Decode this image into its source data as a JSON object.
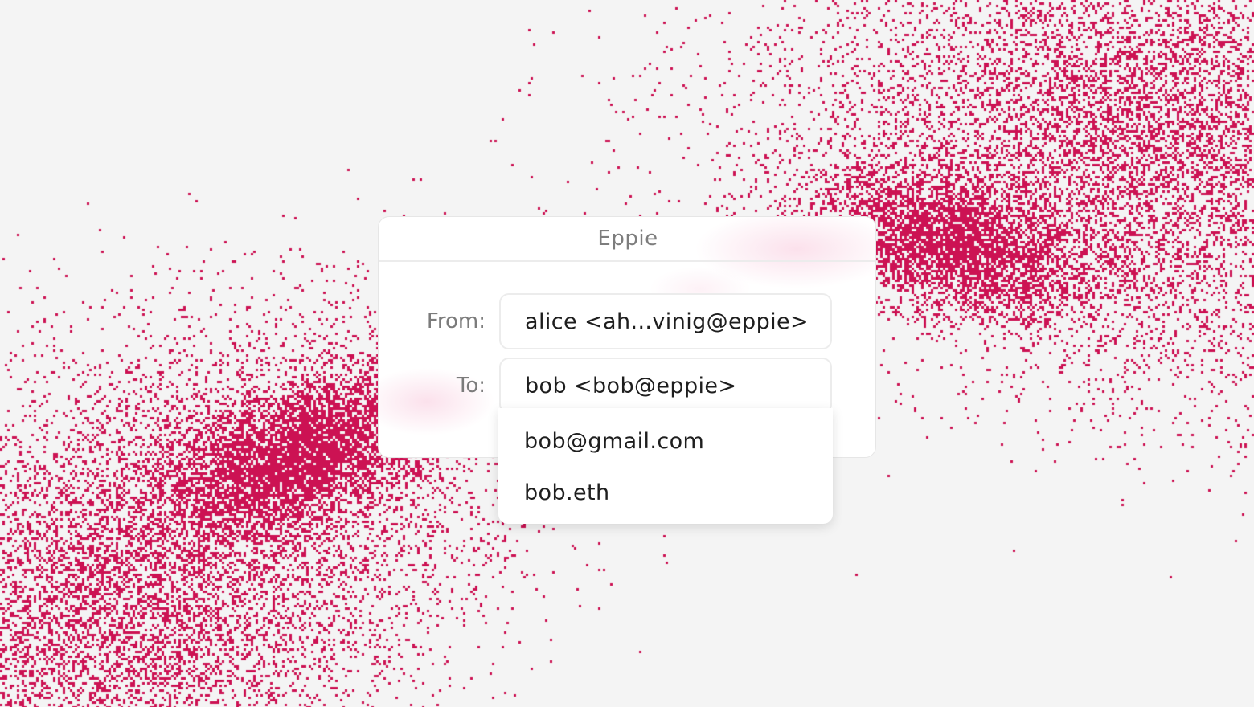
{
  "window": {
    "title": "Eppie"
  },
  "compose": {
    "from_label": "From:",
    "from_value": "alice <ah...vinig@eppie>",
    "to_label": "To:",
    "to_value": "bob <bob@eppie>"
  },
  "suggestions": [
    {
      "label": "bob@gmail.com"
    },
    {
      "label": "bob.eth"
    }
  ],
  "colors": {
    "accent": "#cc1253",
    "background": "#f4f4f4",
    "surface": "#ffffff"
  }
}
